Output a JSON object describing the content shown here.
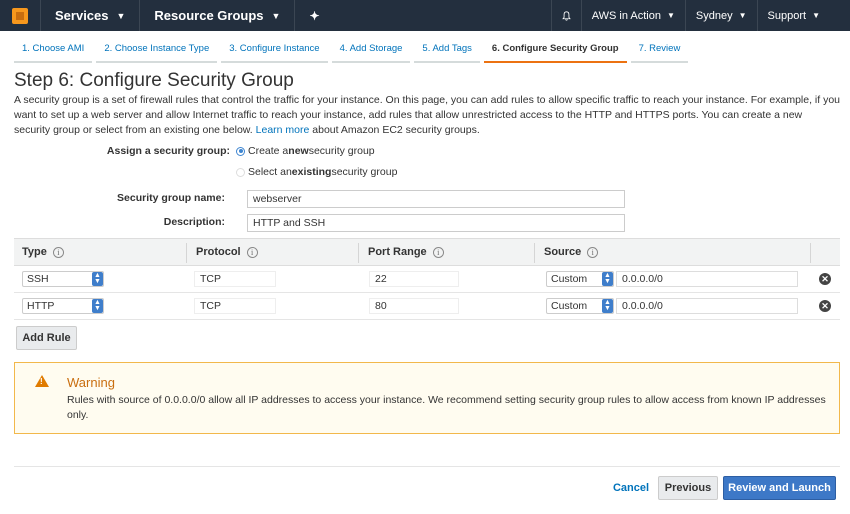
{
  "topbar": {
    "services": "Services",
    "resource_groups": "Resource Groups",
    "account": "AWS in Action",
    "region": "Sydney",
    "support": "Support"
  },
  "tabs": [
    {
      "label": "1. Choose AMI"
    },
    {
      "label": "2. Choose Instance Type"
    },
    {
      "label": "3. Configure Instance"
    },
    {
      "label": "4. Add Storage"
    },
    {
      "label": "5. Add Tags"
    },
    {
      "label": "6. Configure Security Group"
    },
    {
      "label": "7. Review"
    }
  ],
  "page": {
    "title": "Step 6: Configure Security Group",
    "intro": "A security group is a set of firewall rules that control the traffic for your instance. On this page, you can add rules to allow specific traffic to reach your instance. For example, if you want to set up a web server and allow Internet traffic to reach your instance, add rules that allow unrestricted access to the HTTP and HTTPS ports. You can create a new security group or select from an existing one below.",
    "learn_more": "Learn more",
    "intro_suffix": "about Amazon EC2 security groups."
  },
  "form": {
    "assign_label": "Assign a security group:",
    "radio_create": {
      "prefix": "Create a ",
      "bold": "new",
      "suffix": " security group"
    },
    "radio_select": {
      "prefix": "Select an ",
      "bold": "existing",
      "suffix": " security group"
    },
    "name_label": "Security group name:",
    "name_value": "webserver",
    "desc_label": "Description:",
    "desc_value": "HTTP and SSH"
  },
  "rules": {
    "headers": [
      "Type",
      "Protocol",
      "Port Range",
      "Source"
    ],
    "rows": [
      {
        "type": "SSH",
        "protocol": "TCP",
        "port": "22",
        "source_mode": "Custom",
        "source_cidr": "0.0.0.0/0"
      },
      {
        "type": "HTTP",
        "protocol": "TCP",
        "port": "80",
        "source_mode": "Custom",
        "source_cidr": "0.0.0.0/0"
      }
    ],
    "add_rule": "Add Rule"
  },
  "warning": {
    "title": "Warning",
    "text": "Rules with source of 0.0.0.0/0 allow all IP addresses to access your instance. We recommend setting security group rules to allow access from known IP addresses only."
  },
  "footer": {
    "cancel": "Cancel",
    "previous": "Previous",
    "launch": "Review and Launch"
  },
  "colors": {
    "topbar": "#232f3e",
    "accent_orange": "#ec7211",
    "link_blue": "#0073bb",
    "primary_button": "#3d78c7"
  }
}
